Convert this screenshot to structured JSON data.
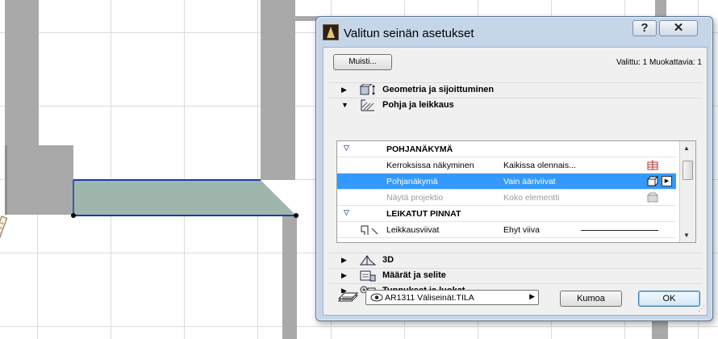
{
  "dialog": {
    "title": "Valitun seinän asetukset",
    "help_label": "?",
    "close_label": "✕",
    "memory_button": "Muisti...",
    "selection_status": "Valittu: 1 Muokattavia: 1"
  },
  "sections": {
    "geometry": "Geometria ja sijoittuminen",
    "floorplan": "Pohja ja leikkaus",
    "model3d": "3D",
    "listing": "Määrät ja selite",
    "tags": "Tunnukset ja luokat"
  },
  "panel": {
    "header1": "POHJANÄKYMÄ",
    "rows": [
      {
        "name": "Kerroksissa näkyminen",
        "value": "Kaikissa olennais..."
      },
      {
        "name": "Pohjanäkymä",
        "value": "Vain ääriviivat"
      },
      {
        "name": "Näytä projektio",
        "value": "Koko elementti"
      }
    ],
    "header2": "LEIKATUT PINNAT",
    "cut_row": {
      "name": "Leikkausviivat",
      "value": "Ehyt viiva"
    }
  },
  "footer": {
    "layer": "AR1311 Väliseinät.TILA",
    "cancel": "Kumoa",
    "ok": "OK"
  },
  "colors": {
    "selection": "#3399ff",
    "wall": "#a9a9a9",
    "wall_fill": "#9fb6ac",
    "wall_outline": "#1a3ca6"
  },
  "icons": [
    "app-logo",
    "help-icon",
    "close-icon",
    "expand-arrow-icon",
    "collapse-arrow-icon",
    "geometry-icon",
    "floorplan-icon",
    "3d-icon",
    "listing-icon",
    "tags-icon",
    "floor-visibility-icon",
    "floorplan-display-icon",
    "projection-icon",
    "cut-line-icon",
    "layer-icon",
    "eye-icon"
  ]
}
